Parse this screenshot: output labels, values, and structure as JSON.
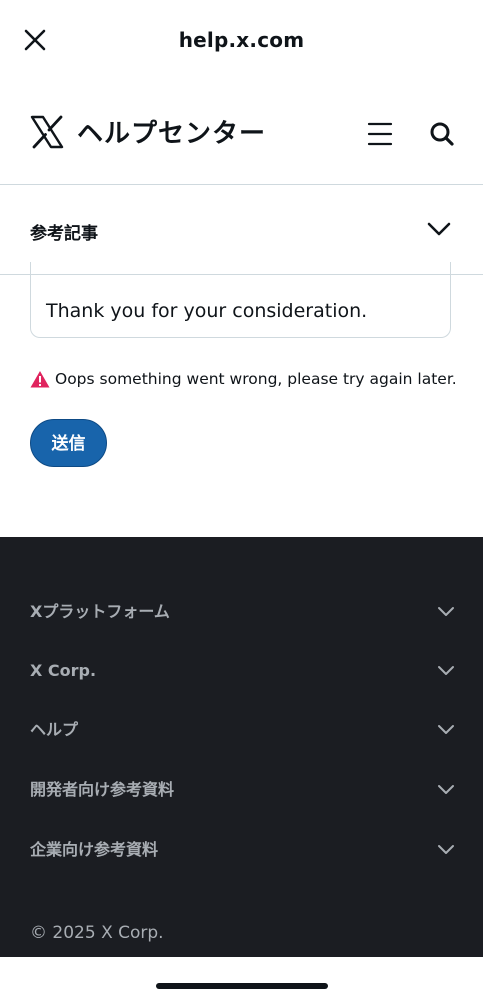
{
  "browser": {
    "url": "help.x.com"
  },
  "header": {
    "brand": "ヘルプセンター"
  },
  "related": {
    "label": "参考記事"
  },
  "form": {
    "textarea_value": "Thank you for your consideration.",
    "error": "Oops something went wrong, please try again later.",
    "submit_label": "送信"
  },
  "footer": {
    "items": [
      {
        "label": "Xプラットフォーム"
      },
      {
        "label": "X Corp."
      },
      {
        "label": "ヘルプ"
      },
      {
        "label": "開発者向け参考資料"
      },
      {
        "label": "企業向け参考資料"
      }
    ],
    "copyright": "© 2025 X Corp."
  },
  "colors": {
    "accent": "#1864ab",
    "footer_bg": "#1b1d22",
    "error": "#e0245e"
  }
}
